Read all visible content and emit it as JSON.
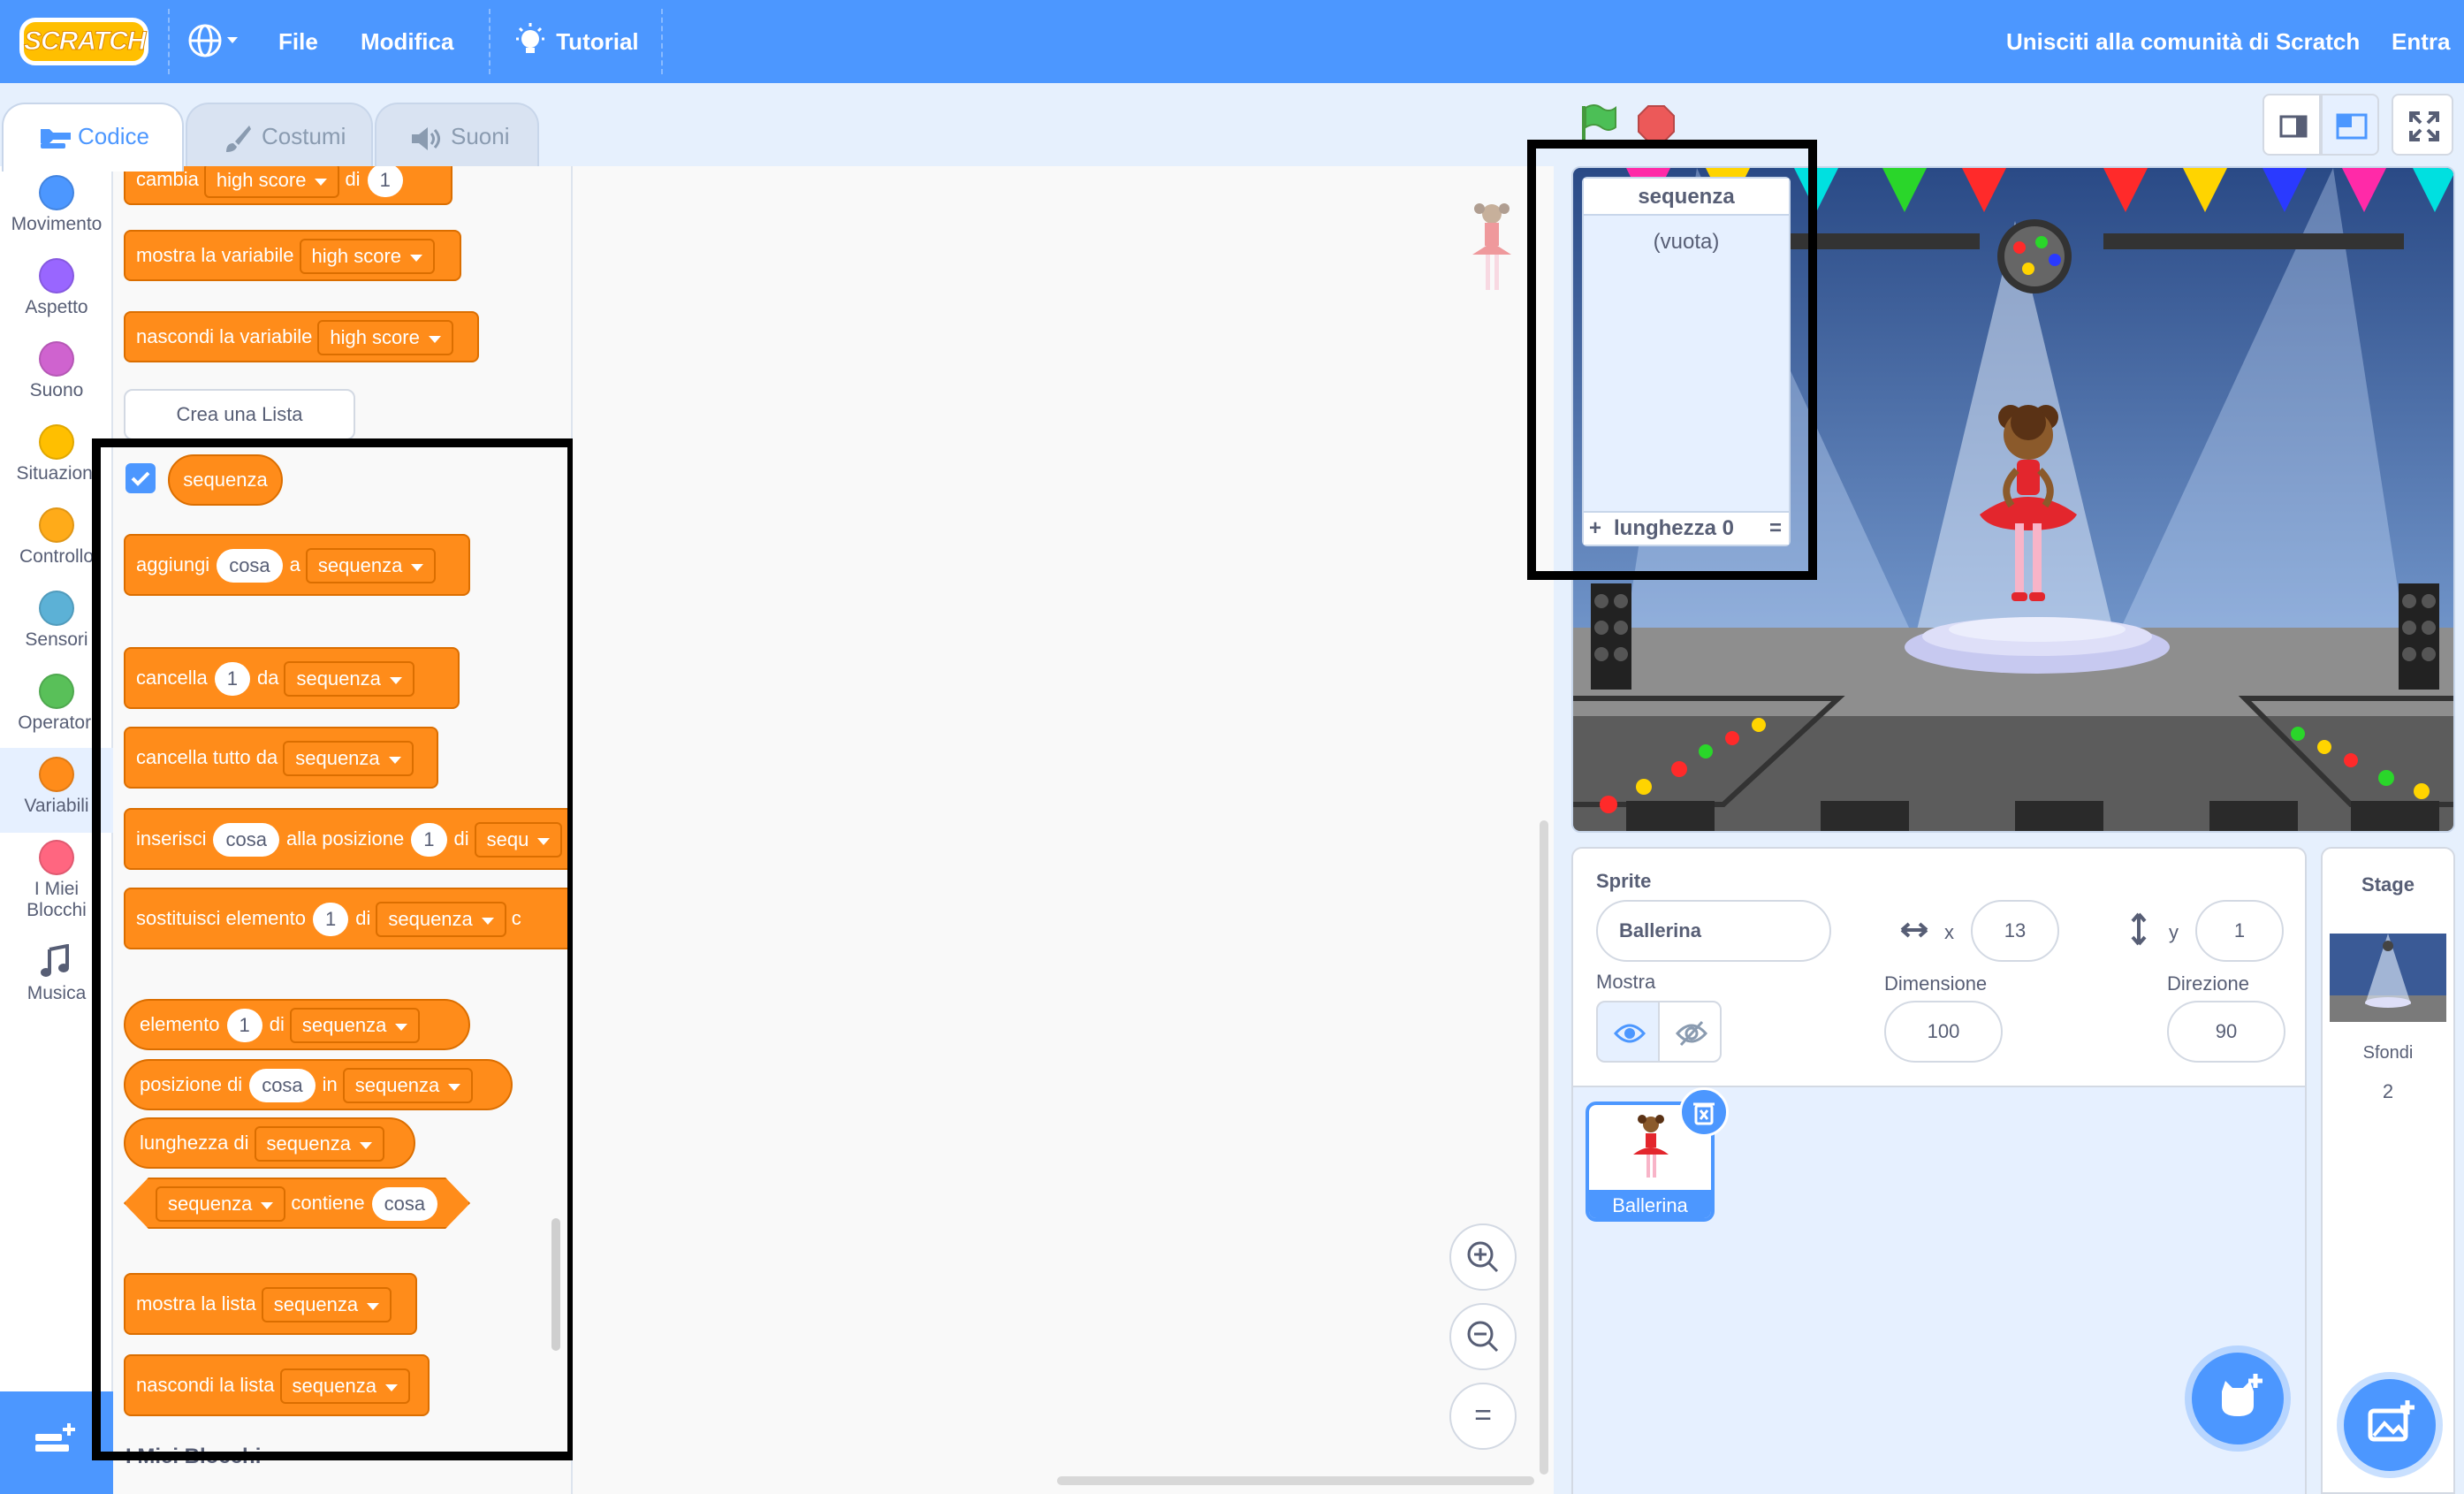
{
  "menu": {
    "logo": "SCRATCH",
    "file": "File",
    "edit": "Modifica",
    "tutorial": "Tutorial",
    "join": "Unisciti alla comunità di Scratch",
    "signin": "Entra"
  },
  "tabs": {
    "code": "Codice",
    "costumes": "Costumi",
    "sounds": "Suoni"
  },
  "categories": [
    {
      "label": "Movimento",
      "color": "#4c97ff"
    },
    {
      "label": "Aspetto",
      "color": "#9966ff"
    },
    {
      "label": "Suono",
      "color": "#cf63cf"
    },
    {
      "label": "Situazioni",
      "color": "#ffbf00"
    },
    {
      "label": "Controllo",
      "color": "#ffab19"
    },
    {
      "label": "Sensori",
      "color": "#5cb1d6"
    },
    {
      "label": "Operatori",
      "color": "#59c059"
    },
    {
      "label": "Variabili",
      "color": "#ff8c1a"
    },
    {
      "label": "I Miei Blocchi",
      "color": "#ff6680"
    },
    {
      "label": "Musica",
      "color": "#0fbd8c"
    }
  ],
  "palette": {
    "change": {
      "t1": "cambia",
      "var": "high score",
      "t2": "di",
      "val": "1"
    },
    "show_var": {
      "t1": "mostra la variabile",
      "var": "high score"
    },
    "hide_var": {
      "t1": "nascondi la variabile",
      "var": "high score"
    },
    "make_list": "Crea una Lista",
    "list_name": "sequenza",
    "add": {
      "t1": "aggiungi",
      "item": "cosa",
      "t2": "a",
      "list": "sequenza"
    },
    "delete": {
      "t1": "cancella",
      "val": "1",
      "t2": "da",
      "list": "sequenza"
    },
    "delete_all": {
      "t1": "cancella tutto da",
      "list": "sequenza"
    },
    "insert": {
      "t1": "inserisci",
      "item": "cosa",
      "t2": "alla posizione",
      "val": "1",
      "t3": "di",
      "list": "sequ"
    },
    "replace": {
      "t1": "sostituisci elemento",
      "val": "1",
      "t2": "di",
      "list": "sequenza",
      "t3": "c"
    },
    "item": {
      "t1": "elemento",
      "val": "1",
      "t2": "di",
      "list": "sequenza"
    },
    "index": {
      "t1": "posizione di",
      "item": "cosa",
      "t2": "in",
      "list": "sequenza"
    },
    "length": {
      "t1": "lunghezza di",
      "list": "sequenza"
    },
    "contains": {
      "list": "sequenza",
      "t1": "contiene",
      "item": "cosa"
    },
    "show_list": {
      "t1": "mostra la lista",
      "list": "sequenza"
    },
    "hide_list": {
      "t1": "nascondi la lista",
      "list": "sequenza"
    },
    "my_blocks": "I Miei Blocchi"
  },
  "stage_monitor": {
    "title": "sequenza",
    "empty": "(vuota)",
    "plus": "+",
    "length": "lunghezza 0",
    "eq": "="
  },
  "sprite": {
    "label": "Sprite",
    "name": "Ballerina",
    "x_label": "x",
    "x": "13",
    "y_label": "y",
    "y": "1",
    "show_label": "Mostra",
    "size_label": "Dimensione",
    "size": "100",
    "dir_label": "Direzione",
    "dir": "90",
    "thumb_label": "Ballerina"
  },
  "stage_pane": {
    "title": "Stage",
    "backdrops_label": "Sfondi",
    "backdrops": "2"
  },
  "zoom": {
    "reset": "="
  }
}
